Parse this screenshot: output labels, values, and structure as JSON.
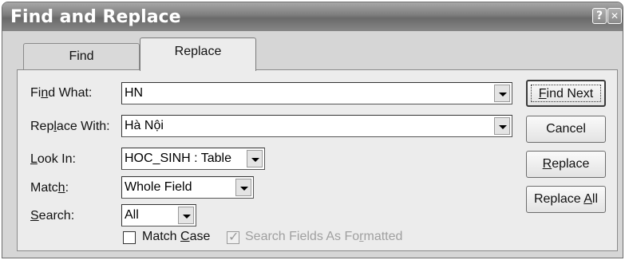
{
  "window": {
    "title": "Find and Replace",
    "help_symbol": "?",
    "close_symbol": "✕"
  },
  "tabs": [
    {
      "label": "Find"
    },
    {
      "label": "Replace"
    }
  ],
  "form": {
    "find_what": {
      "label_pre": "Fi",
      "label_key": "n",
      "label_post": "d What:",
      "value": "HN"
    },
    "replace_with": {
      "label_pre": "Rep",
      "label_key": "l",
      "label_post": "ace With:",
      "value": "Hà Nội"
    },
    "look_in": {
      "label_pre": "",
      "label_key": "L",
      "label_post": "ook In:",
      "value": "HOC_SINH : Table"
    },
    "match": {
      "label_pre": "Matc",
      "label_key": "h",
      "label_post": ":",
      "value": "Whole Field"
    },
    "search": {
      "label_pre": "",
      "label_key": "S",
      "label_post": "earch:",
      "value": "All"
    }
  },
  "checkboxes": {
    "match_case": {
      "label_pre": "Match ",
      "label_key": "C",
      "label_post": "ase",
      "checked": false
    },
    "search_formatted": {
      "label_pre": "Search Fields As Fo",
      "label_key": "r",
      "label_post": "matted",
      "checked": true,
      "disabled": true
    }
  },
  "buttons": {
    "find_next": {
      "label_pre": "",
      "label_key": "F",
      "label_post": "ind Next"
    },
    "cancel": {
      "label": "Cancel"
    },
    "replace": {
      "label_pre": "",
      "label_key": "R",
      "label_post": "eplace"
    },
    "replace_all": {
      "label_pre": "Replace ",
      "label_key": "A",
      "label_post": "ll"
    }
  }
}
